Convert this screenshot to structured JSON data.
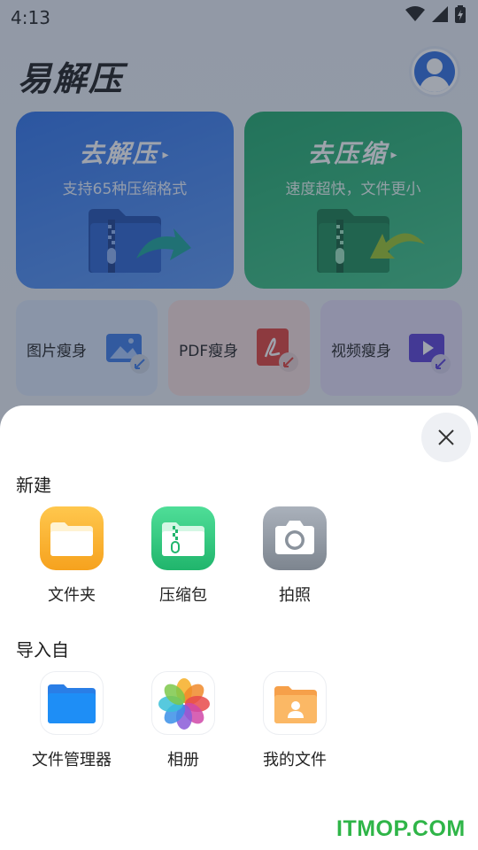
{
  "status_bar": {
    "time": "4:13"
  },
  "app": {
    "title": "易解压",
    "cards": [
      {
        "title": "去解压",
        "subtitle": "支持65种压缩格式",
        "arrow": "▸"
      },
      {
        "title": "去压缩",
        "subtitle": "速度超快，文件更小",
        "arrow": "▸"
      }
    ],
    "tools": [
      {
        "label": "图片瘦身"
      },
      {
        "label": "PDF瘦身"
      },
      {
        "label": "视频瘦身"
      }
    ]
  },
  "sheet": {
    "sections": [
      {
        "title": "新建",
        "items": [
          {
            "label": "文件夹",
            "icon": "folder-icon"
          },
          {
            "label": "压缩包",
            "icon": "zip-archive-icon"
          },
          {
            "label": "拍照",
            "icon": "camera-icon"
          }
        ]
      },
      {
        "title": "导入自",
        "items": [
          {
            "label": "文件管理器",
            "icon": "file-manager-icon"
          },
          {
            "label": "相册",
            "icon": "photos-icon"
          },
          {
            "label": "我的文件",
            "icon": "my-files-icon"
          }
        ]
      }
    ]
  },
  "watermark": "ITMOP.COM"
}
